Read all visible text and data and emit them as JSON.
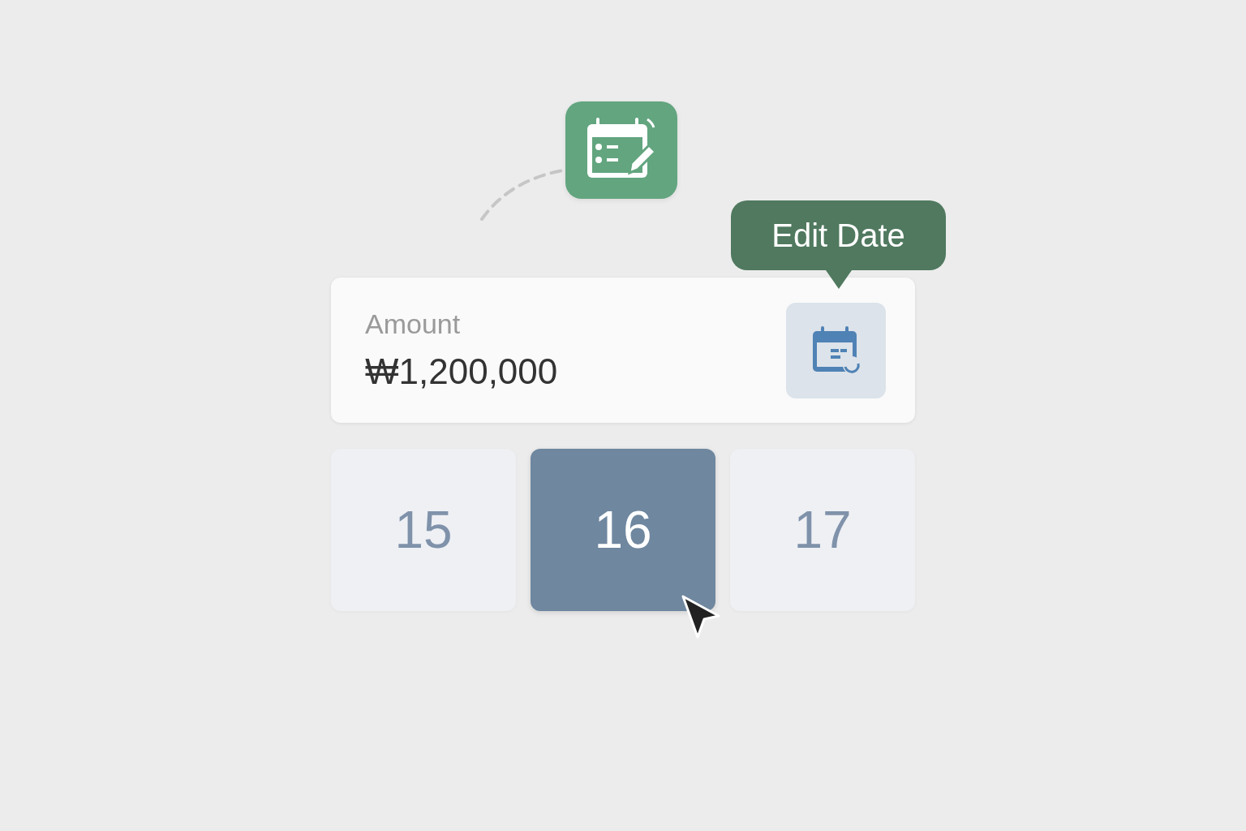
{
  "tooltip": {
    "text": "Edit Date"
  },
  "amount": {
    "label": "Amount",
    "value": "₩1,200,000"
  },
  "days": [
    {
      "label": "15",
      "selected": false
    },
    {
      "label": "16",
      "selected": true
    },
    {
      "label": "17",
      "selected": false
    }
  ]
}
